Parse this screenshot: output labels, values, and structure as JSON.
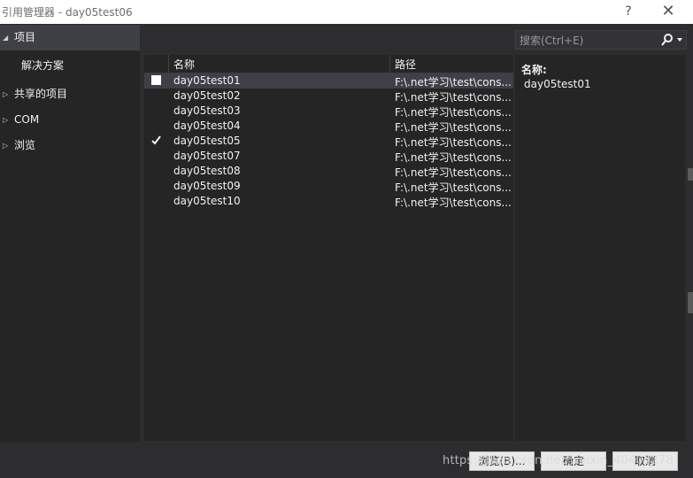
{
  "window": {
    "title": "引用管理器 - day05test06",
    "help_glyph": "?",
    "close_glyph": "✕"
  },
  "nav": {
    "items": [
      {
        "label": "项目",
        "expanded": true,
        "selected": true
      },
      {
        "label": "解决方案",
        "child": true
      },
      {
        "label": "共享的项目",
        "expanded": false
      },
      {
        "label": "COM",
        "expanded": false
      },
      {
        "label": "浏览",
        "expanded": false
      }
    ]
  },
  "search": {
    "placeholder": "搜索(Ctrl+E)"
  },
  "list": {
    "columns": {
      "name": "名称",
      "path": "路径"
    },
    "rows": [
      {
        "name": "day05test01",
        "path": "F:\\.net学习\\test\\cons...",
        "checked": false,
        "selected": true
      },
      {
        "name": "day05test02",
        "path": "F:\\.net学习\\test\\cons...",
        "checked": false
      },
      {
        "name": "day05test03",
        "path": "F:\\.net学习\\test\\cons...",
        "checked": false
      },
      {
        "name": "day05test04",
        "path": "F:\\.net学习\\test\\cons...",
        "checked": false
      },
      {
        "name": "day05test05",
        "path": "F:\\.net学习\\test\\cons...",
        "checked": true
      },
      {
        "name": "day05test07",
        "path": "F:\\.net学习\\test\\cons...",
        "checked": false
      },
      {
        "name": "day05test08",
        "path": "F:\\.net学习\\test\\cons...",
        "checked": false
      },
      {
        "name": "day05test09",
        "path": "F:\\.net学习\\test\\cons...",
        "checked": false
      },
      {
        "name": "day05test10",
        "path": "F:\\.net学习\\test\\cons...",
        "checked": false
      }
    ]
  },
  "detail": {
    "label": "名称:",
    "value": "day05test01"
  },
  "buttons": {
    "browse": "浏览(B)...",
    "ok": "确定",
    "cancel": "取消"
  },
  "watermark": "https://blog.csdn.net/weixin_40405278",
  "colors": {
    "accent_check": "#f1f1f1",
    "panel_bg": "#252526",
    "window_bg": "#2d2d30"
  }
}
